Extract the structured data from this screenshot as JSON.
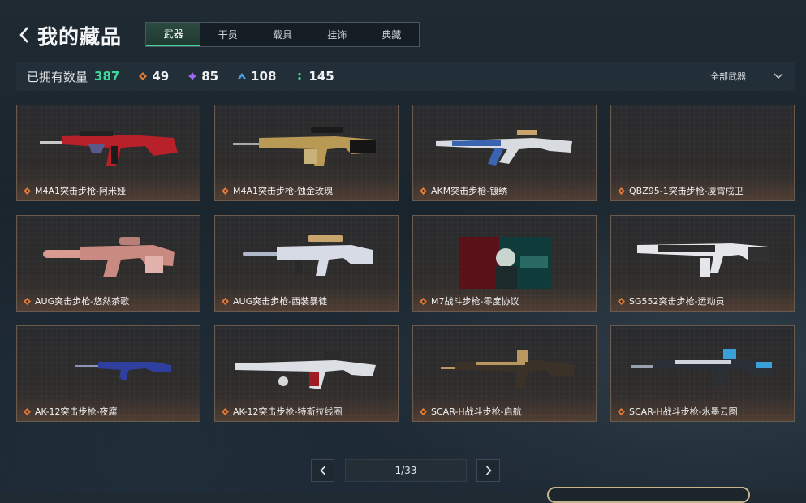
{
  "header": {
    "title": "我的藏品"
  },
  "tabs": [
    {
      "label": "武器",
      "active": true
    },
    {
      "label": "干员"
    },
    {
      "label": "载具"
    },
    {
      "label": "挂饰"
    },
    {
      "label": "典藏"
    }
  ],
  "stats": {
    "owned_label": "已拥有数量",
    "owned_count": "387",
    "tiers": [
      {
        "icon": "orange-diamond-icon",
        "color": "#e07b39",
        "count": "49"
      },
      {
        "icon": "purple-diamond-icon",
        "color": "#9a6cf0",
        "count": "85"
      },
      {
        "icon": "blue-chevron-icon",
        "color": "#4aa3e6",
        "count": "108"
      },
      {
        "icon": "green-dots-icon",
        "color": "#3fd79b",
        "count": "145"
      }
    ]
  },
  "filter": {
    "label": "全部武器"
  },
  "items": [
    {
      "name": "M4A1突击步枪-阿米娅"
    },
    {
      "name": "M4A1突击步枪-蚀金玫瑰"
    },
    {
      "name": "AKM突击步枪-镀绣"
    },
    {
      "name": "QBZ95-1突击步枪-凌霄戍卫"
    },
    {
      "name": "AUG突击步枪-悠然茶歌"
    },
    {
      "name": "AUG突击步枪-西装暴徒"
    },
    {
      "name": "M7战斗步枪-零度协议"
    },
    {
      "name": "SG552突击步枪-运动员"
    },
    {
      "name": "AK-12突击步枪-夜腐"
    },
    {
      "name": "AK-12突击步枪-特斯拉线圈"
    },
    {
      "name": "SCAR-H战斗步枪-启航"
    },
    {
      "name": "SCAR-H战斗步枪-水墨云图"
    }
  ],
  "pagination": {
    "page_text": "1/33"
  },
  "colors": {
    "accent": "#3fd79b",
    "rarity": "#e07b39"
  }
}
